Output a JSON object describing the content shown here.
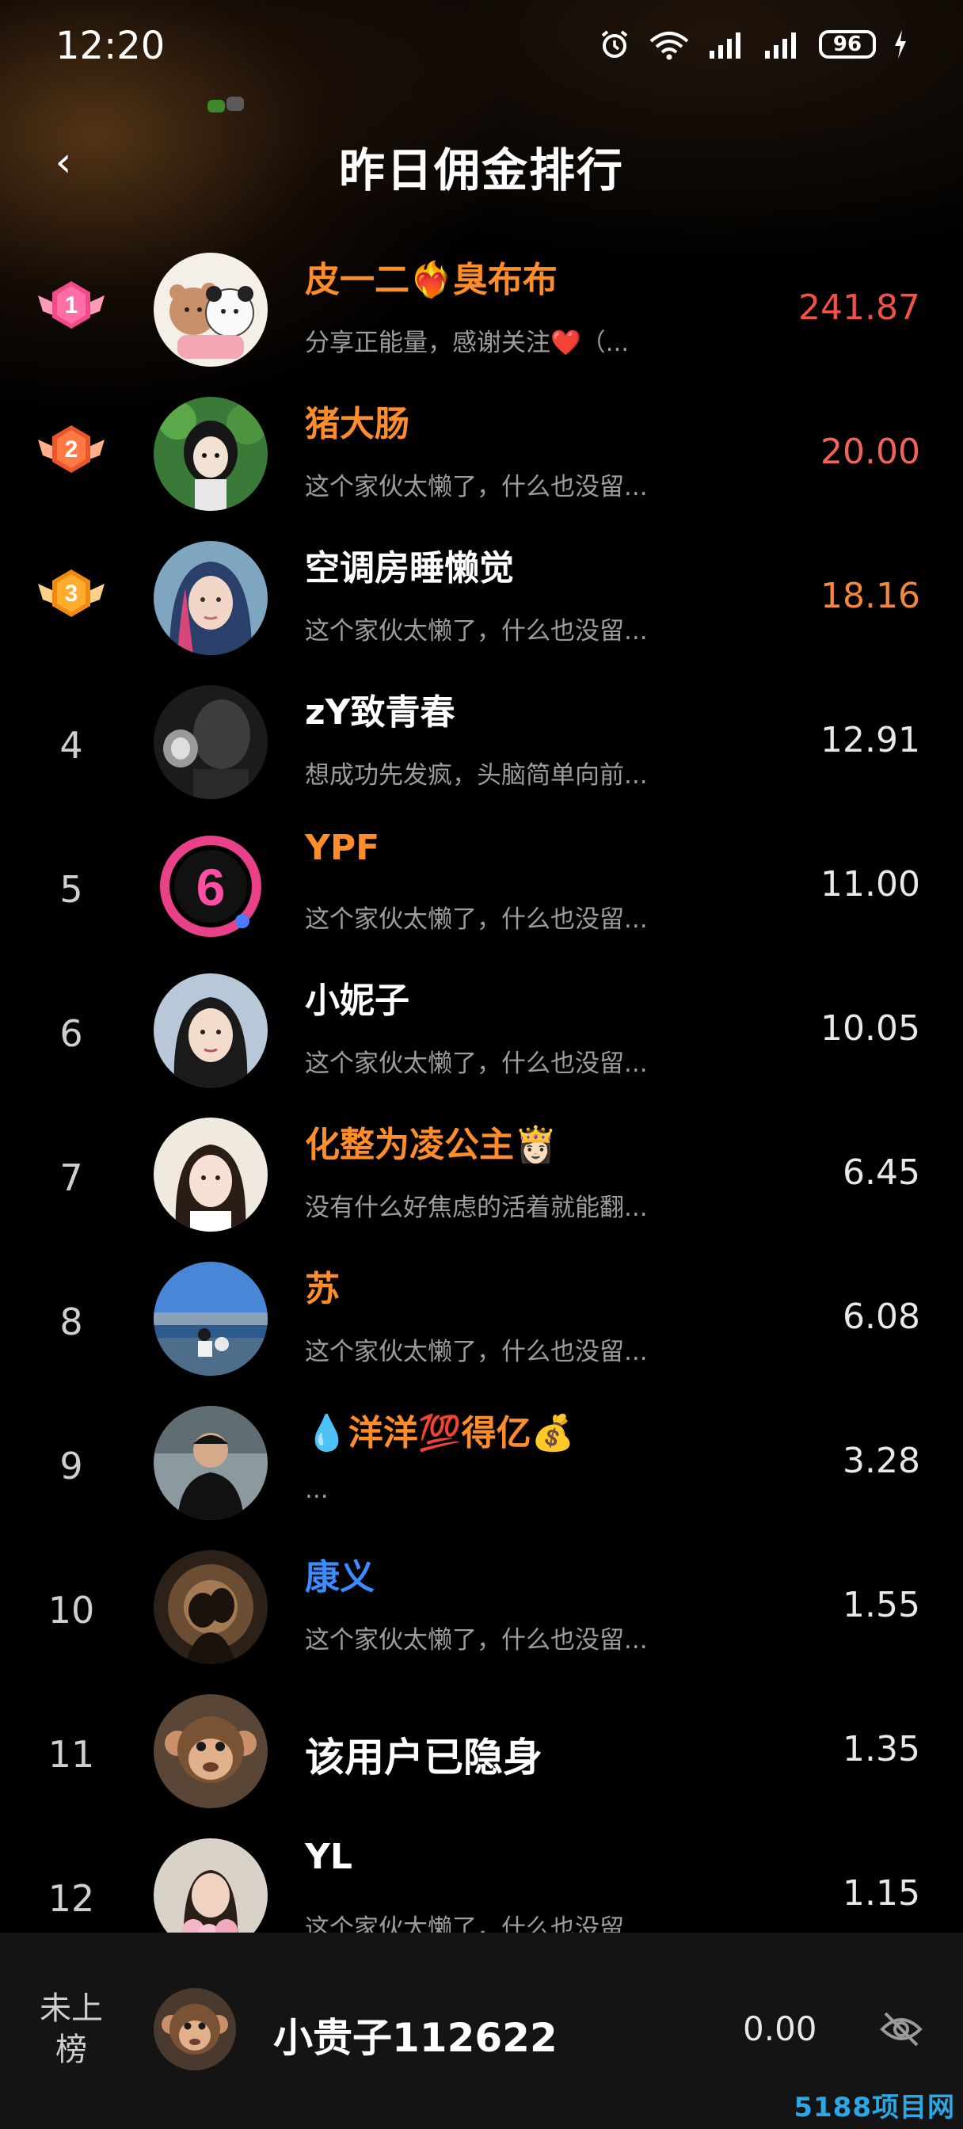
{
  "status_bar": {
    "time": "12:20",
    "battery": "96"
  },
  "header": {
    "title": "昨日佣金排行",
    "back_symbol": "‹"
  },
  "rows": [
    {
      "rank": "1",
      "name": "皮一二❤️‍🔥臭布布",
      "bio": "分享正能量，感谢关注❤️（...",
      "amount": "241.87"
    },
    {
      "rank": "2",
      "name": "猪大肠",
      "bio": "这个家伙太懒了，什么也没留...",
      "amount": "20.00"
    },
    {
      "rank": "3",
      "name": "空调房睡懒觉",
      "bio": "这个家伙太懒了，什么也没留...",
      "amount": "18.16"
    },
    {
      "rank": "4",
      "name": "zY致青春",
      "bio": "想成功先发疯，头脑简单向前...",
      "amount": "12.91"
    },
    {
      "rank": "5",
      "name": "YPF",
      "bio": "这个家伙太懒了，什么也没留...",
      "amount": "11.00"
    },
    {
      "rank": "6",
      "name": "小妮子",
      "bio": "这个家伙太懒了，什么也没留...",
      "amount": "10.05"
    },
    {
      "rank": "7",
      "name": "化整为凌公主👸🏻",
      "bio": "没有什么好焦虑的活着就能翻...",
      "amount": "6.45"
    },
    {
      "rank": "8",
      "name": "苏",
      "bio": "这个家伙太懒了，什么也没留...",
      "amount": "6.08"
    },
    {
      "rank": "9",
      "name": "💧洋洋💯得亿💰",
      "bio": "...",
      "amount": "3.28"
    },
    {
      "rank": "10",
      "name": "康义",
      "bio": "这个家伙太懒了，什么也没留...",
      "amount": "1.55"
    },
    {
      "rank": "11",
      "name": "该用户已隐身",
      "bio": "",
      "amount": "1.35"
    },
    {
      "rank": "12",
      "name": "YL",
      "bio": "这个家伙太懒了，什么也没留...",
      "amount": "1.15"
    }
  ],
  "me": {
    "rank_label": "未上榜",
    "name": "小贵子112622",
    "amount": "0.00"
  },
  "watermark": "5188项目网",
  "colors": {
    "first": "#f0524a",
    "second": "#f2645a",
    "third": "#f4893a",
    "name_orange": "#ff8d2a",
    "name_blue": "#3a8cff"
  }
}
